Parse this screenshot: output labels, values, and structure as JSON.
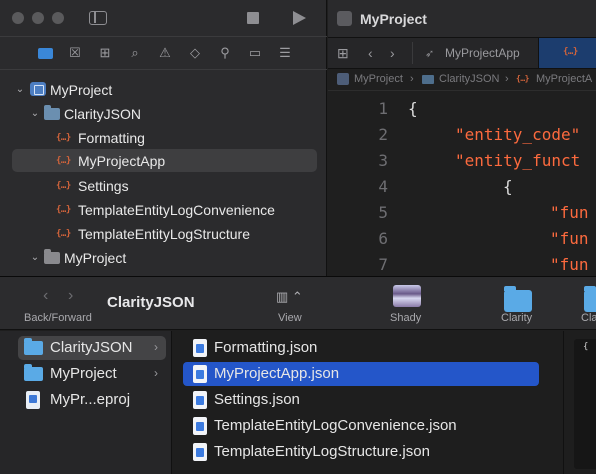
{
  "xcode": {
    "window_title": "MyProject",
    "tab_label": "MyProjectApp",
    "breadcrumb": [
      "MyProject",
      "ClarityJSON",
      "MyProjectA"
    ],
    "tree": [
      {
        "label": "MyProject"
      },
      {
        "label": "ClarityJSON"
      },
      {
        "label": "Formatting"
      },
      {
        "label": "MyProjectApp"
      },
      {
        "label": "Settings"
      },
      {
        "label": "TemplateEntityLogConvenience"
      },
      {
        "label": "TemplateEntityLogStructure"
      },
      {
        "label": "MyProject"
      }
    ],
    "code_lines": [
      {
        "num": "1",
        "text": "{"
      },
      {
        "num": "2",
        "text": "\"entity_code\""
      },
      {
        "num": "3",
        "text": "\"entity_funct"
      },
      {
        "num": "4",
        "text": "{"
      },
      {
        "num": "5",
        "text": "\"fun"
      },
      {
        "num": "6",
        "text": "\"fun"
      },
      {
        "num": "7",
        "text": "\"fun"
      }
    ]
  },
  "finder": {
    "back_forward_label": "Back/Forward",
    "folder_title": "ClarityJSON",
    "view_label": "View",
    "toolbar_items": [
      {
        "label": "Shady"
      },
      {
        "label": "Clarity"
      },
      {
        "label": "Cla"
      }
    ],
    "sidebar": [
      {
        "label": "ClarityJSON"
      },
      {
        "label": "MyProject"
      },
      {
        "label": "MyPr...eproj"
      }
    ],
    "files": [
      {
        "name": "Formatting.json"
      },
      {
        "name": "MyProjectApp.json"
      },
      {
        "name": "Settings.json"
      },
      {
        "name": "TemplateEntityLogConvenience.json"
      },
      {
        "name": "TemplateEntityLogStructure.json"
      }
    ],
    "preview_text": "{"
  },
  "colors": {
    "selection_blue": "#2456c9",
    "json_string": "#fc6a3e",
    "folder_blue": "#5aaae6"
  }
}
